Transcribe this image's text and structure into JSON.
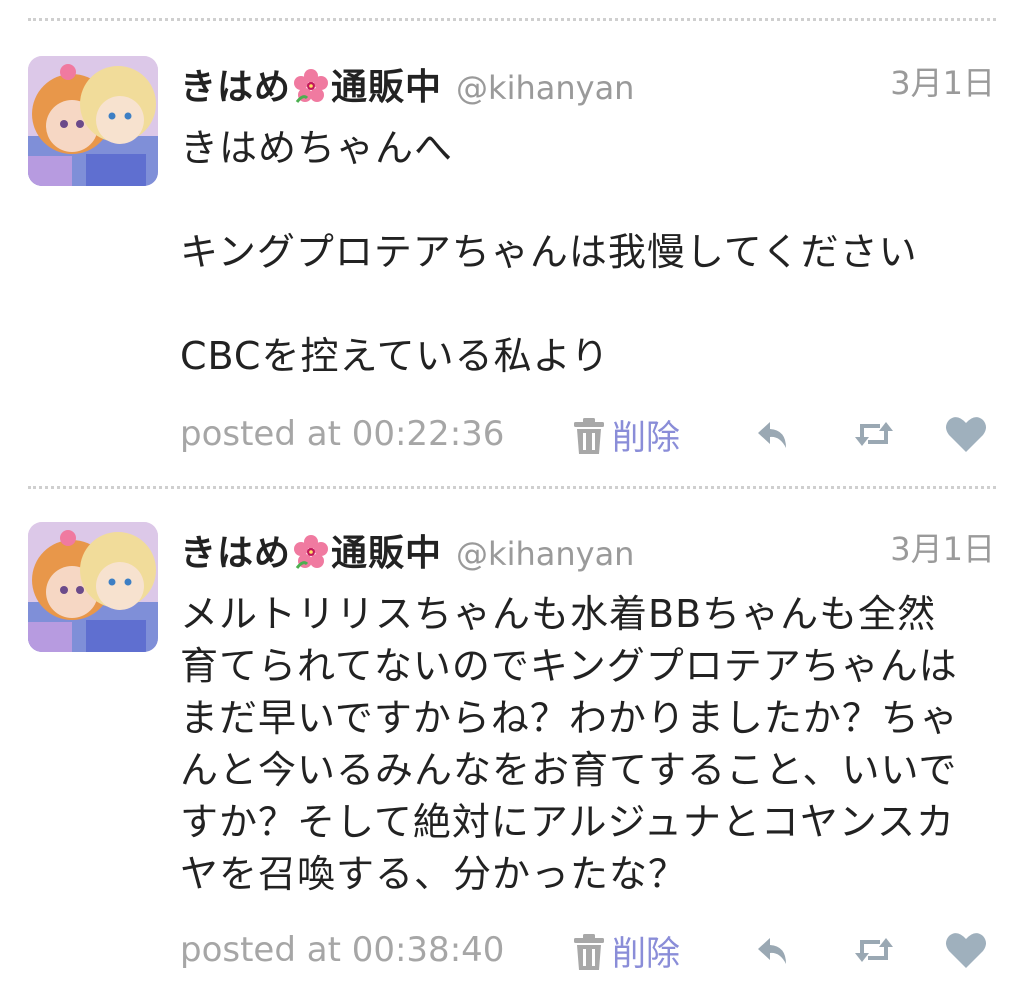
{
  "tweets": [
    {
      "display_name": "きはめ",
      "display_name_suffix": "通販中",
      "screen_name": "@kihanyan",
      "date": "3月1日",
      "text": "きはめちゃんへ\n\nキングプロテアちゃんは我慢してください\n\nCBCを控えている私より",
      "posted": "posted at 00:22:36",
      "delete_label": "削除"
    },
    {
      "display_name": "きはめ",
      "display_name_suffix": "通販中",
      "screen_name": "@kihanyan",
      "date": "3月1日",
      "text": "メルトリリスちゃんも水着BBちゃんも全然\n育てられてないのでキングプロテアちゃんは\nまだ早いですからね？わかりましたか？ちゃ\nんと今いるみんなをお育てすること、いいで\nすか？そして絶対にアルジュナとコヤンスカ\nヤを召喚する、分かったな？",
      "posted": "posted at 00:38:40",
      "delete_label": "削除"
    }
  ],
  "icons": {
    "name_emoji": "hibiscus-icon",
    "delete": "trash-icon",
    "reply": "reply-icon",
    "retweet": "retweet-icon",
    "like": "heart-icon"
  },
  "colors": {
    "delete_accent": "#8a8dd8",
    "action_icon": "#9aa8b3",
    "heart": "#9fb0bd",
    "muted_text": "#9a9a9a",
    "flower": "#f07aa0"
  }
}
